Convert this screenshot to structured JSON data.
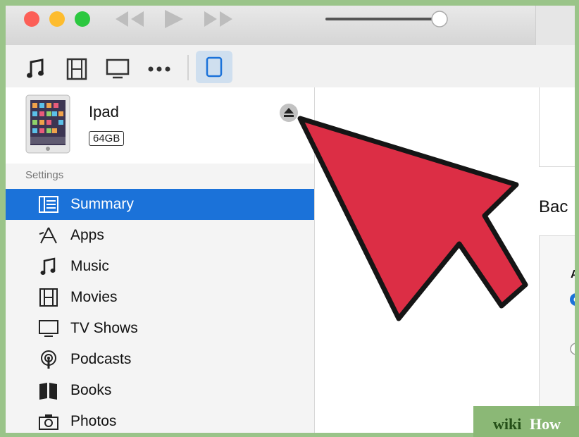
{
  "device": {
    "name": "Ipad",
    "capacity": "64GB"
  },
  "sidebar": {
    "section_title": "Settings",
    "items": [
      {
        "label": "Summary",
        "icon": "summary-icon",
        "active": true
      },
      {
        "label": "Apps",
        "icon": "apps-icon"
      },
      {
        "label": "Music",
        "icon": "music-note-icon"
      },
      {
        "label": "Movies",
        "icon": "film-icon"
      },
      {
        "label": "TV Shows",
        "icon": "tv-icon"
      },
      {
        "label": "Podcasts",
        "icon": "podcast-icon"
      },
      {
        "label": "Books",
        "icon": "books-icon"
      },
      {
        "label": "Photos",
        "icon": "camera-icon"
      }
    ]
  },
  "content": {
    "backups_title_partial": "Bac",
    "section_label_partial": "A"
  },
  "toolbar": {
    "icons": [
      "music-note-icon",
      "film-icon",
      "tv-icon",
      "more-icon",
      "ipad-icon"
    ]
  },
  "watermark": {
    "wiki": "wiki",
    "how": "How"
  },
  "colors": {
    "selection": "#1b72d9",
    "arrow": "#dc2e45",
    "watermark_bg": "#8bb876"
  }
}
